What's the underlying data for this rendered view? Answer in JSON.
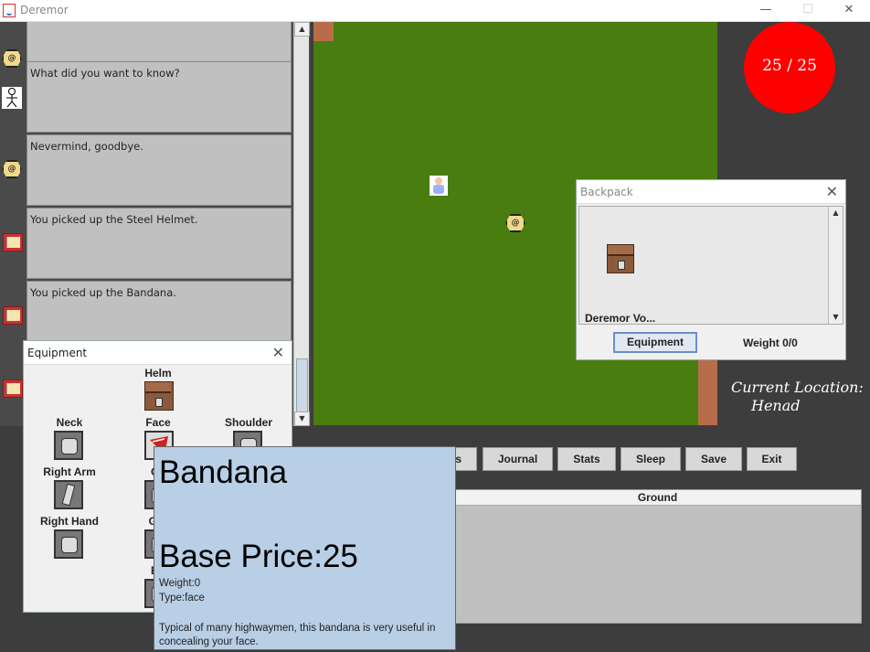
{
  "window": {
    "title": "Deremor",
    "minimize": "—",
    "maximize": "☐",
    "close": "✕"
  },
  "chat": {
    "messages": [
      {
        "avatar": "hex-at-icon",
        "text": ""
      },
      {
        "avatar": "stick-figure-icon",
        "text": "What did you want to know?"
      },
      {
        "avatar": "hex-at-icon",
        "text": "Nevermind, goodbye."
      },
      {
        "avatar": "book-icon",
        "text": "You picked up the Steel Helmet."
      },
      {
        "avatar": "book-icon",
        "text": "You picked up the Bandana."
      },
      {
        "avatar": "book-icon",
        "text": ""
      }
    ]
  },
  "player_symbol": "@",
  "health": {
    "text": "25 / 25"
  },
  "location": {
    "heading": "Current Location:",
    "value": "Henad"
  },
  "toolbar": {
    "partial_label": "s",
    "journal": "Journal",
    "stats": "Stats",
    "sleep": "Sleep",
    "save": "Save",
    "exit": "Exit"
  },
  "ground": {
    "header": "Ground"
  },
  "backpack": {
    "title": "Backpack",
    "item_label": "Deremor Vo...",
    "equipment_button": "Equipment",
    "weight": "Weight 0/0"
  },
  "equipment": {
    "title": "Equipment",
    "slots": {
      "helm": "Helm",
      "neck": "Neck",
      "face": "Face",
      "shoulder": "Shoulder",
      "right_arm": "Right Arm",
      "chest": "Ch",
      "right_hand": "Right Hand",
      "greaves": "Gre",
      "boots": "Bo"
    }
  },
  "tooltip": {
    "name": "Bandana",
    "price": "Base Price:25",
    "weight": "Weight:0",
    "type": "Type:face",
    "description": "Typical of many highwaymen, this bandana is very useful in concealing your face."
  },
  "colors": {
    "health": "#ff0000",
    "grass": "#4a7d10",
    "tooltip_bg": "#b8cfe6"
  }
}
